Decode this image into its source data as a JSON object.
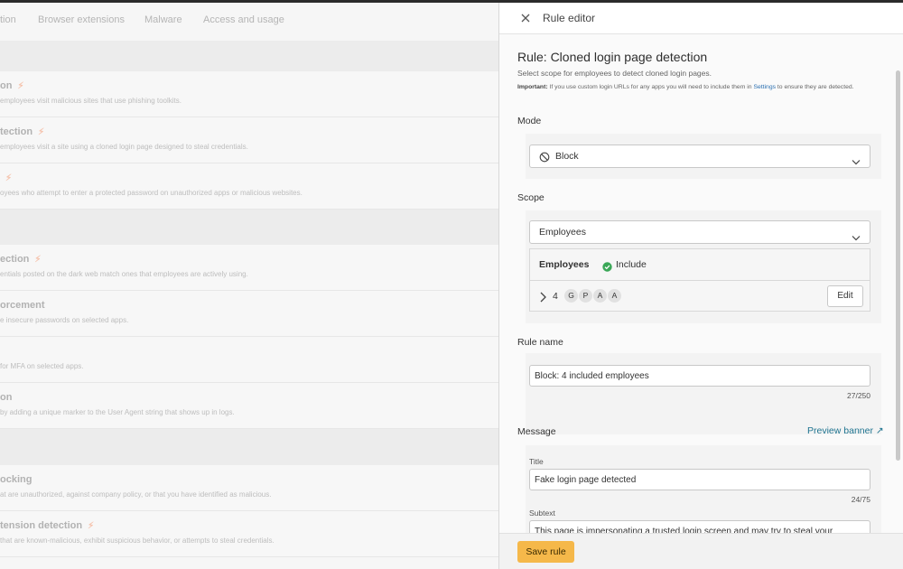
{
  "background": {
    "tabs": [
      "tion",
      "Browser extensions",
      "Malware",
      "Access and usage"
    ],
    "rows": [
      {
        "title": "on",
        "desc": "employees visit malicious sites that use phishing toolkits.",
        "bolt": true
      },
      {
        "title": "tection",
        "desc": "employees visit a site using a cloned login page designed to steal credentials.",
        "bolt": true
      },
      {
        "title": "",
        "desc": "oyees who attempt to enter a protected password on unauthorized apps or malicious websites.",
        "bolt": true
      },
      {
        "title": "ection",
        "desc": "entials posted on the dark web match ones that employees are actively using.",
        "bolt": true
      },
      {
        "title": "orcement",
        "desc": "e insecure passwords on selected apps.",
        "bolt": false
      },
      {
        "title": "",
        "desc": "for MFA on selected apps.",
        "bolt": false
      },
      {
        "title": "on",
        "desc": "by adding a unique marker to the User Agent string that shows up in logs.",
        "bolt": false
      },
      {
        "title": "ocking",
        "desc": "at are unauthorized, against company policy, or that you have identified as malicious.",
        "bolt": false
      },
      {
        "title": "tension detection",
        "desc": "that are known-malicious, exhibit suspicious behavior, or attempts to steal credentials.",
        "bolt": true
      }
    ]
  },
  "panel": {
    "header_title": "Rule editor",
    "rule_heading": "Rule: Cloned login page detection",
    "rule_subtitle": "Select scope for employees to detect cloned login pages.",
    "important_label": "Important:",
    "important_text_before": " If you use custom login URLs for any apps you will need to include them in ",
    "important_link": "Settings",
    "important_text_after": " to ensure they are detected.",
    "mode_label": "Mode",
    "mode_value": "Block",
    "scope_label": "Scope",
    "scope_value": "Employees",
    "employees_label": "Employees",
    "include_label": "Include",
    "employee_count": "4",
    "avatars": [
      "G",
      "P",
      "A",
      "A"
    ],
    "edit_label": "Edit",
    "rule_name_label": "Rule name",
    "rule_name_value": "Block: 4 included employees",
    "rule_name_counter": "27/250",
    "message_label": "Message",
    "preview_label": "Preview banner ↗",
    "title_label": "Title",
    "title_value": "Fake login page detected",
    "title_counter": "24/75",
    "subtext_label": "Subtext",
    "subtext_value": "This page is impersonating a trusted login screen and may try to steal your",
    "save_label": "Save rule"
  },
  "colors": {
    "accent": "#f5b84a",
    "link": "#1f7490",
    "include_check": "#3aa757",
    "bolt": "#f5c3ad"
  }
}
